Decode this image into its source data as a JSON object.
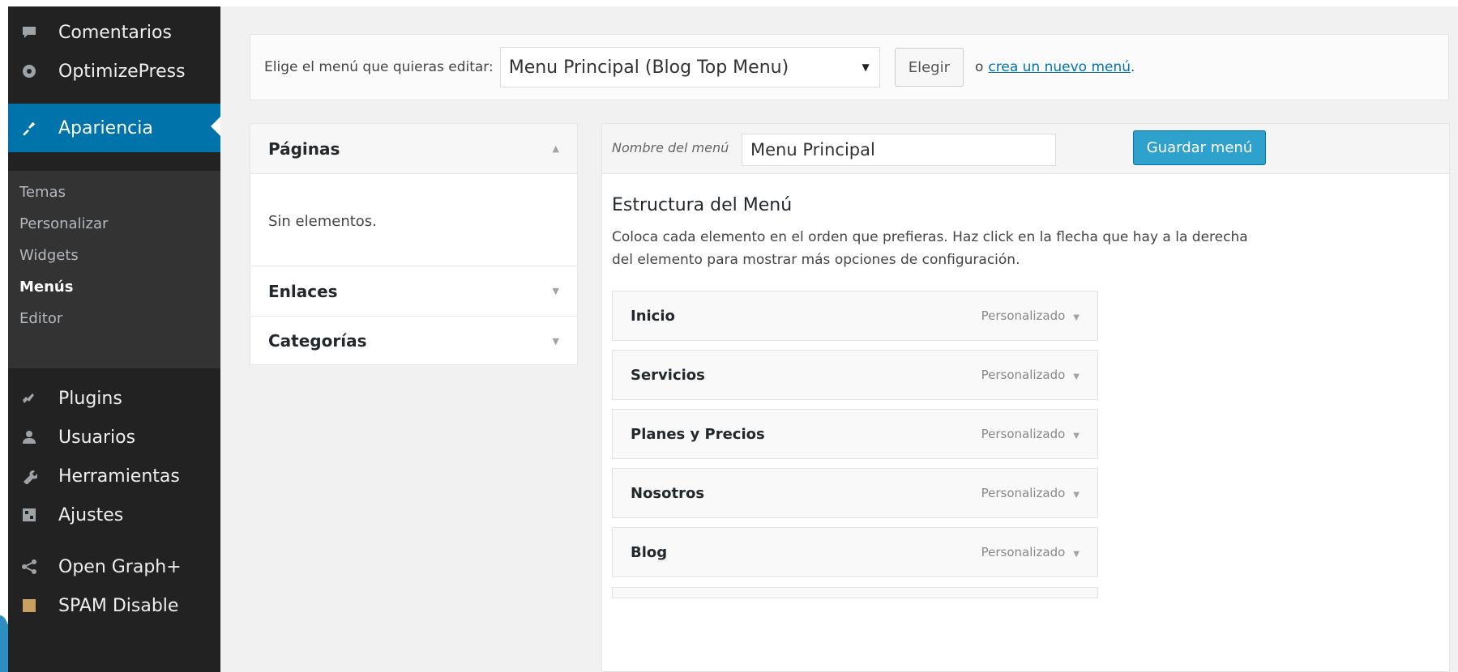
{
  "sidebar": {
    "items_top": [
      {
        "label": "Comentarios",
        "icon": "comments-icon"
      },
      {
        "label": "OptimizePress",
        "icon": "optimizepress-icon"
      }
    ],
    "current": {
      "label": "Apariencia",
      "icon": "appearance-icon"
    },
    "submenu": [
      {
        "label": "Temas"
      },
      {
        "label": "Personalizar"
      },
      {
        "label": "Widgets"
      },
      {
        "label": "Menús"
      },
      {
        "label": "Editor"
      }
    ],
    "items_bottom": [
      {
        "label": "Plugins",
        "icon": "plugins-icon"
      },
      {
        "label": "Usuarios",
        "icon": "users-icon"
      },
      {
        "label": "Herramientas",
        "icon": "tools-icon"
      },
      {
        "label": "Ajustes",
        "icon": "settings-icon"
      },
      {
        "label": "Open Graph+",
        "icon": "share-icon"
      },
      {
        "label": "SPAM Disable",
        "icon": "spam-icon"
      }
    ]
  },
  "picker": {
    "label": "Elige el menú que quieras editar:",
    "selected": "Menu Principal (Blog Top Menu)",
    "button": "Elegir",
    "or_text": "o",
    "create_link": "crea un nuevo menú",
    "period": "."
  },
  "accordion": {
    "sections": [
      {
        "title": "Páginas",
        "body": "Sin elementos."
      },
      {
        "title": "Enlaces"
      },
      {
        "title": "Categorías"
      }
    ]
  },
  "manage": {
    "name_label": "Nombre del menú",
    "name_value": "Menu Principal",
    "save_button": "Guardar menú",
    "structure_title": "Estructura del Menú",
    "structure_desc": "Coloca cada elemento en el orden que prefieras. Haz click en la flecha que hay a la derecha del elemento para mostrar más opciones de configuración.",
    "items": [
      {
        "title": "Inicio",
        "type": "Personalizado"
      },
      {
        "title": "Servicios",
        "type": "Personalizado"
      },
      {
        "title": "Planes y Precios",
        "type": "Personalizado"
      },
      {
        "title": "Nosotros",
        "type": "Personalizado"
      },
      {
        "title": "Blog",
        "type": "Personalizado"
      }
    ]
  },
  "colors": {
    "sidebar_bg": "#222222",
    "current_bg": "#0073aa",
    "save_button": "#2ea2cc",
    "link": "#0073aa"
  }
}
